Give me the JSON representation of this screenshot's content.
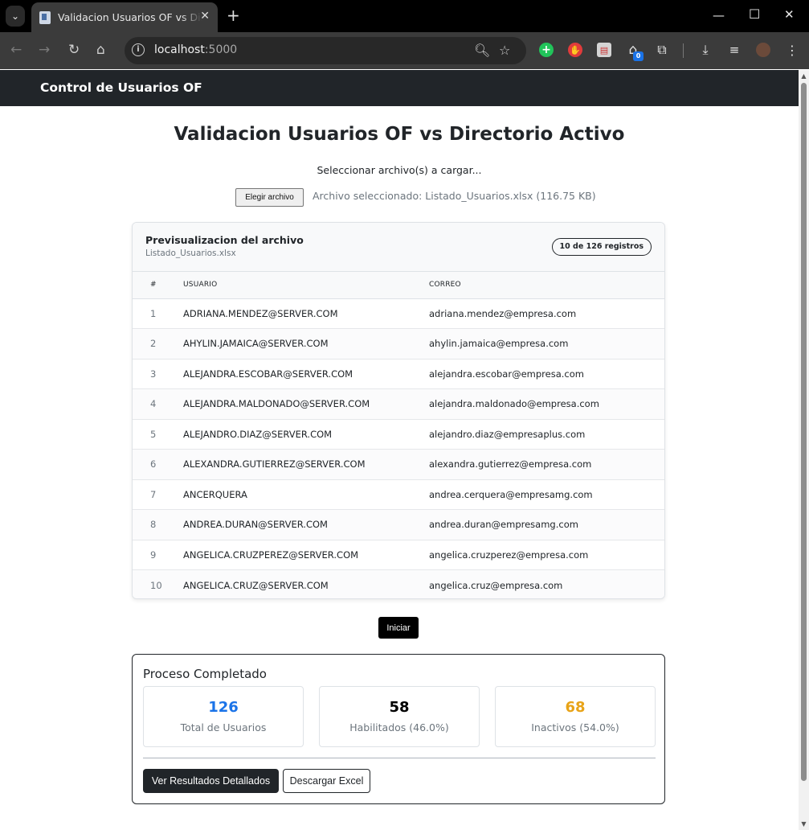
{
  "browser": {
    "tab_title": "Validacion Usuarios OF vs Directorio Activo",
    "url_host": "localhost",
    "url_port": ":5000",
    "ext_badge": "0"
  },
  "app": {
    "brand": "Control de Usuarios OF",
    "title": "Validacion Usuarios OF vs Directorio Activo",
    "select_label": "Seleccionar archivo(s) a cargar...",
    "file_button": "Elegir archivo",
    "file_info": "Archivo seleccionado: Listado_Usuarios.xlsx (116.75 KB)"
  },
  "preview": {
    "title": "Previsualizacion del archivo",
    "filename": "Listado_Usuarios.xlsx",
    "badge": "10 de 126 registros",
    "columns": [
      "#",
      "USUARIO",
      "CORREO"
    ],
    "rows": [
      {
        "n": "1",
        "user": "ADRIANA.MENDEZ@SERVER.COM",
        "email": "adriana.mendez@empresa.com"
      },
      {
        "n": "2",
        "user": "AHYLIN.JAMAICA@SERVER.COM",
        "email": "ahylin.jamaica@empresa.com"
      },
      {
        "n": "3",
        "user": "ALEJANDRA.ESCOBAR@SERVER.COM",
        "email": "alejandra.escobar@empresa.com"
      },
      {
        "n": "4",
        "user": "ALEJANDRA.MALDONADO@SERVER.COM",
        "email": "alejandra.maldonado@empresa.com"
      },
      {
        "n": "5",
        "user": "ALEJANDRO.DIAZ@SERVER.COM",
        "email": "alejandro.diaz@empresaplus.com"
      },
      {
        "n": "6",
        "user": "ALEXANDRA.GUTIERREZ@SERVER.COM",
        "email": "alexandra.gutierrez@empresa.com"
      },
      {
        "n": "7",
        "user": "ANCERQUERA",
        "email": "andrea.cerquera@empresamg.com"
      },
      {
        "n": "8",
        "user": "ANDREA.DURAN@SERVER.COM",
        "email": "andrea.duran@empresamg.com"
      },
      {
        "n": "9",
        "user": "ANGELICA.CRUZPEREZ@SERVER.COM",
        "email": "angelica.cruzperez@empresa.com"
      },
      {
        "n": "10",
        "user": "ANGELICA.CRUZ@SERVER.COM",
        "email": "angelica.cruz@empresa.com"
      }
    ]
  },
  "start_button": "Iniciar",
  "results": {
    "title": "Proceso Completado",
    "stats": [
      {
        "value": "126",
        "label": "Total de Usuarios",
        "color": "#1a73e8"
      },
      {
        "value": "58",
        "label": "Habilitados (46.0%)",
        "color": "#000000"
      },
      {
        "value": "68",
        "label": "Inactivos (54.0%)",
        "color": "#e8a317"
      }
    ],
    "details_button": "Ver Resultados Detallados",
    "download_button": "Descargar Excel"
  }
}
